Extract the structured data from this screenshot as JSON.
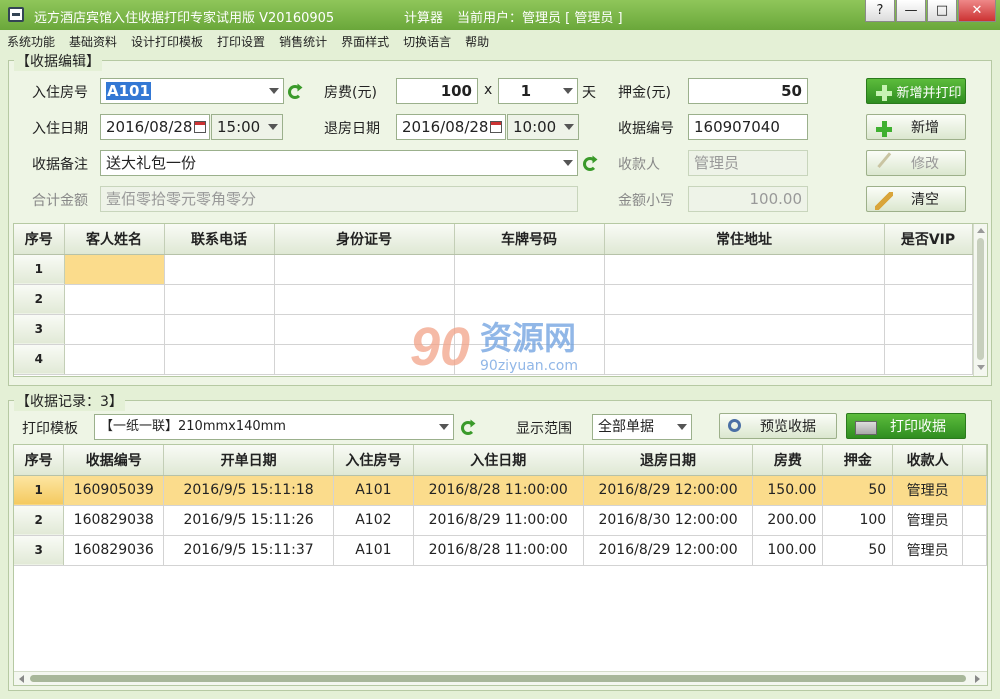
{
  "window": {
    "title": "远方酒店宾馆入住收据打印专家试用版 V20160905",
    "calculator": "计算器",
    "current_user": "当前用户：管理员 [ 管理员 ]",
    "buttons": {
      "help": "?",
      "minimize": "—",
      "maximize": "□",
      "close": "✕"
    }
  },
  "menu": [
    "系统功能",
    "基础资料",
    "设计打印模板",
    "打印设置",
    "销售统计",
    "界面样式",
    "切换语言",
    "帮助"
  ],
  "editor": {
    "legend": "【收据编辑】",
    "room_label": "入住房号",
    "room_value": "A101",
    "rate_label": "房费(元)",
    "rate_value": "100",
    "times": "x",
    "days_value": "1",
    "days_unit": "天",
    "deposit_label": "押金(元)",
    "deposit_value": "50",
    "checkin_label": "入住日期",
    "checkin_date": "2016/08/28",
    "checkin_time": "15:00",
    "checkout_label": "退房日期",
    "checkout_date": "2016/08/28",
    "checkout_time": "10:00",
    "receipt_no_label": "收据编号",
    "receipt_no_value": "160907040",
    "note_label": "收据备注",
    "note_value": "送大礼包一份",
    "cashier_label": "收款人",
    "cashier_value": "管理员",
    "total_label": "合计金额",
    "total_value": "壹佰零拾零元零角零分",
    "amount_label": "金额小写",
    "amount_value": "100.00",
    "btn_add_print": "新增并打印",
    "btn_add": "新增",
    "btn_edit": "修改",
    "btn_clear": "清空"
  },
  "guests": {
    "headers": [
      "序号",
      "客人姓名",
      "联系电话",
      "身份证号",
      "车牌号码",
      "常住地址",
      "是否VIP"
    ],
    "rows": [
      "1",
      "2",
      "3",
      "4"
    ]
  },
  "records": {
    "legend": "【收据记录：3】",
    "template_label": "打印模板",
    "template_value": "【一纸一联】210mmx140mm",
    "range_label": "显示范围",
    "range_value": "全部单据",
    "btn_preview": "预览收据",
    "btn_print": "打印收据",
    "headers": [
      "序号",
      "收据编号",
      "开单日期",
      "入住房号",
      "入住日期",
      "退房日期",
      "房费",
      "押金",
      "收款人"
    ],
    "rows": [
      [
        "1",
        "160905039",
        "2016/9/5 15:11:18",
        "A101",
        "2016/8/28 11:00:00",
        "2016/8/29 12:00:00",
        "150.00",
        "50",
        "管理员"
      ],
      [
        "2",
        "160829038",
        "2016/9/5 15:11:26",
        "A102",
        "2016/8/29 11:00:00",
        "2016/8/30 12:00:00",
        "200.00",
        "100",
        "管理员"
      ],
      [
        "3",
        "160829036",
        "2016/9/5 15:11:37",
        "A101",
        "2016/8/28 11:00:00",
        "2016/8/29 12:00:00",
        "100.00",
        "50",
        "管理员"
      ]
    ]
  },
  "watermark": {
    "number": "90",
    "cn": "资源网",
    "en": "90ziyuan.com"
  }
}
